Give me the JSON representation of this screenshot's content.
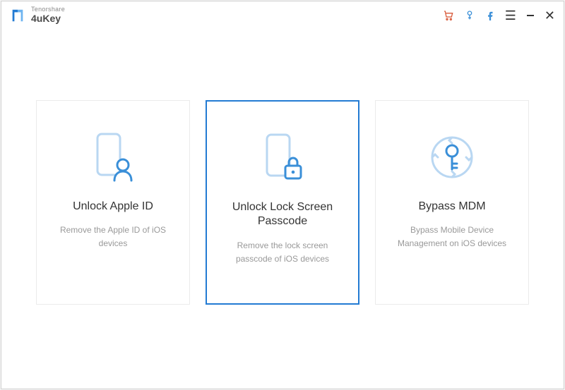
{
  "brand": {
    "company": "Tenorshare",
    "product": "4uKey"
  },
  "cards": [
    {
      "title": "Unlock Apple ID",
      "desc": "Remove the Apple ID of iOS devices"
    },
    {
      "title": "Unlock Lock Screen Passcode",
      "desc": "Remove the lock screen passcode of iOS devices"
    },
    {
      "title": "Bypass MDM",
      "desc": "Bypass Mobile Device Management on iOS devices"
    }
  ]
}
